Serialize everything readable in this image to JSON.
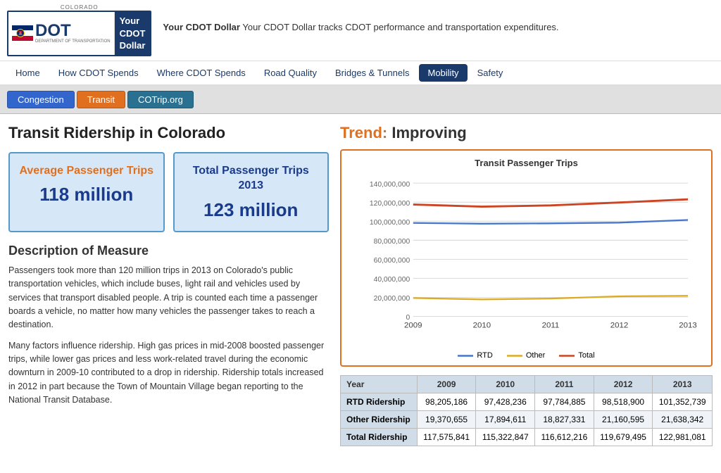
{
  "header": {
    "logo": {
      "colorado_text": "COLORADO",
      "dot_text": "DOT",
      "dept_text": "DEPARTMENT OF TRANSPORTATION",
      "brand_text": "Your CDOT Dollar"
    },
    "tagline": "Your CDOT Dollar tracks CDOT performance and transportation expenditures.",
    "nav": [
      {
        "label": "Home",
        "active": false
      },
      {
        "label": "How CDOT Spends",
        "active": false
      },
      {
        "label": "Where CDOT Spends",
        "active": false
      },
      {
        "label": "Road Quality",
        "active": false
      },
      {
        "label": "Bridges & Tunnels",
        "active": false
      },
      {
        "label": "Mobility",
        "active": true
      },
      {
        "label": "Safety",
        "active": false
      }
    ]
  },
  "sub_tabs": [
    {
      "label": "Congestion",
      "color": "blue"
    },
    {
      "label": "Transit",
      "color": "orange"
    },
    {
      "label": "COTrip.org",
      "color": "teal"
    }
  ],
  "page": {
    "title": "Transit Ridership in Colorado",
    "trend_label": "Trend:",
    "trend_value": "Improving"
  },
  "stat_boxes": [
    {
      "label": "Average Passenger Trips",
      "value": "118 million",
      "label_color": "orange"
    },
    {
      "label": "Total Passenger Trips 2013",
      "value": "123 million",
      "label_color": "blue"
    }
  ],
  "description": {
    "title": "Description of Measure",
    "paragraphs": [
      "Passengers took more than 120 million trips in 2013 on Colorado's public transportation vehicles, which include buses, light rail and vehicles used by services that transport disabled people. A trip is counted each time a passenger boards a vehicle, no matter how many vehicles the passenger takes to reach a destination.",
      "Many factors influence ridership. High gas prices in mid-2008 boosted passenger trips, while lower gas prices and less work-related travel during the economic downturn in 2009-10 contributed to a drop in ridership. Ridership totals increased in 2012 in part because the Town of Mountain Village began reporting to the National Transit Database."
    ]
  },
  "chart": {
    "title": "Transit Passenger Trips",
    "years": [
      "2009",
      "2010",
      "2011",
      "2012",
      "2013"
    ],
    "y_labels": [
      "0",
      "20,000,000",
      "40,000,000",
      "60,000,000",
      "80,000,000",
      "100,000,000",
      "120,000,000",
      "140,000,000"
    ],
    "rtd_data": [
      98205186,
      97428236,
      97784885,
      98518900,
      101352739
    ],
    "other_data": [
      19370655,
      17894611,
      18827331,
      21160595,
      21638342
    ],
    "total_data": [
      117575841,
      115322847,
      116612216,
      119679495,
      122981081
    ],
    "legend": [
      {
        "label": "RTD",
        "color": "#4477cc"
      },
      {
        "label": "Other",
        "color": "#ddaa22"
      },
      {
        "label": "Total",
        "color": "#cc4422"
      }
    ]
  },
  "table": {
    "headers": [
      "Year",
      "2009",
      "2010",
      "2011",
      "2012",
      "2013"
    ],
    "rows": [
      {
        "label": "RTD Ridership",
        "values": [
          "98,205,186",
          "97,428,236",
          "97,784,885",
          "98,518,900",
          "101,352,739"
        ]
      },
      {
        "label": "Other Ridership",
        "values": [
          "19,370,655",
          "17,894,611",
          "18,827,331",
          "21,160,595",
          "21,638,342"
        ]
      },
      {
        "label": "Total Ridership",
        "values": [
          "117,575,841",
          "115,322,847",
          "116,612,216",
          "119,679,495",
          "122,981,081"
        ]
      }
    ]
  }
}
